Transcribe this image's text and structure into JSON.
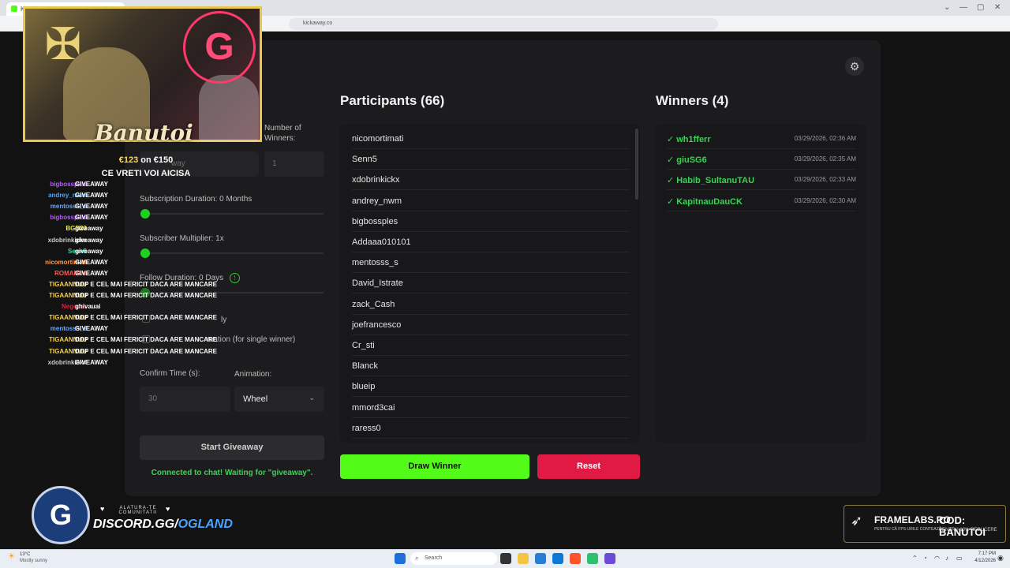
{
  "browser": {
    "tab_title": "Kic",
    "address": "kickaway.co",
    "window_controls": [
      "⌄",
      "—",
      "▢",
      "✕"
    ]
  },
  "app": {
    "participants_heading": "Participants (66)",
    "winners_heading": "Winners (4)",
    "participants": [
      "nicomortimati",
      "Senn5",
      "xdobrinkickx",
      "andrey_nwm",
      "bigbossples",
      "Addaaa010101",
      "mentosss_s",
      "David_Istrate",
      "zack_Cash",
      "joefrancesco",
      "Cr_sti",
      "Blanck",
      "blueip",
      "mmord3cai",
      "raress0"
    ],
    "winners": [
      {
        "name": "wh1fferr",
        "time": "03/29/2026, 02:36 AM"
      },
      {
        "name": "giuSG6",
        "time": "03/29/2026, 02:35 AM"
      },
      {
        "name": "Habib_SultanuTAU",
        "time": "03/29/2026, 02:33 AM"
      },
      {
        "name": "KapitnauDauCK",
        "time": "03/29/2026, 02:30 AM"
      }
    ],
    "winner_check": "✓",
    "number_of_winners_label": "Number of Winners:",
    "keyword_placeholder": "way",
    "number_of_winners_value": "1",
    "subscription_duration_label": "Subscription Duration: 0 Months",
    "subscriber_multiplier_label": "Subscriber Multiplier: 1x",
    "follow_duration_label": "Follow Duration:  0  Days",
    "checkbox_1_label": "ly",
    "checkbox_2_label": "mation (for single winner)",
    "confirm_time_label": "Confirm Time (s):",
    "confirm_time_value": "30",
    "animation_label": "Animation:",
    "animation_value": "Wheel",
    "start_button": "Start Giveaway",
    "status": "Connected to chat! Waiting for \"giveaway\".",
    "draw_button": "Draw Winner",
    "reset_button": "Reset"
  },
  "overlay": {
    "streamer_name": "Banutoi",
    "goal_current": "€123",
    "goal_rest": " on €150",
    "cta": "CE VRETI VOI AICISA",
    "logo_letter": "G",
    "badge_letter": "G",
    "join_text": "ALATURA-TE COMUNITATII",
    "discord_prefix": "DISCORD.GG/",
    "discord_suffix": "OGLAND",
    "sponsor_brand": "FRAMELABS.RO",
    "sponsor_brand_sub": "PENTRU CĂ FPS-URILE CONTEAZĂ",
    "sponsor_code": "COD: BANUTOI",
    "sponsor_code_sub": "PENTRU 10% REDUCERE",
    "chat": [
      {
        "user": "bigbossples",
        "color": "#b65cff",
        "msg": "GIVEAWAY"
      },
      {
        "user": "andrey_nwm",
        "color": "#4aa3ff",
        "msg": "GIVEAWAY"
      },
      {
        "user": "mentosss_s",
        "color": "#6aa8ff",
        "msg": "GIVEAWAY"
      },
      {
        "user": "bigbossples",
        "color": "#b65cff",
        "msg": "GIVEAWAY"
      },
      {
        "user": "BGD23",
        "color": "#e8e85a",
        "msg": "giveaway"
      },
      {
        "user": "xdobrinkickx",
        "color": "#cfcfcf",
        "msg": "giveaway"
      },
      {
        "user": "Senn5",
        "color": "#39d3b0",
        "msg": "giveaway"
      },
      {
        "user": "nicomortimati",
        "color": "#ff9b4a",
        "msg": "GIVEAWAY"
      },
      {
        "user": "ROMANUu",
        "color": "#ff5a5a",
        "msg": "GIVEAWAY"
      },
      {
        "user": "TIGAANNUU",
        "color": "#f2d24a",
        "msg": "DOP E CEL MAI FERICIT DACA ARE MANCARE"
      },
      {
        "user": "TIGAANNUU",
        "color": "#f2d24a",
        "msg": "DOP E CEL MAI FERICIT DACA ARE MANCARE"
      },
      {
        "user": "Negocar",
        "color": "#e0203a",
        "msg": "ghivauai"
      },
      {
        "user": "TIGAANNUU",
        "color": "#f2d24a",
        "msg": "DOP E CEL MAI FERICIT DACA ARE MANCARE"
      },
      {
        "user": "mentosss_s",
        "color": "#6aa8ff",
        "msg": "GIVEAWAY"
      },
      {
        "user": "TIGAANNUU",
        "color": "#f2d24a",
        "msg": "DOP E CEL MAI FERICIT DACA ARE MANCARE"
      },
      {
        "user": "TIGAANNUU",
        "color": "#f2d24a",
        "msg": "DOP E CEL MAI FERICIT DACA ARE MANCARE"
      },
      {
        "user": "xdobrinkickx",
        "color": "#cfcfcf",
        "msg": "GIVEAWAY"
      }
    ]
  },
  "taskbar": {
    "weather_temp": "13°C",
    "weather_desc": "Mostly sunny",
    "search_placeholder": "Search",
    "time": "7:17 PM",
    "date": "4/12/2026"
  },
  "colors": {
    "accent_green": "#53fc18",
    "reset_red": "#e01a45",
    "winner_green": "#39d353"
  }
}
